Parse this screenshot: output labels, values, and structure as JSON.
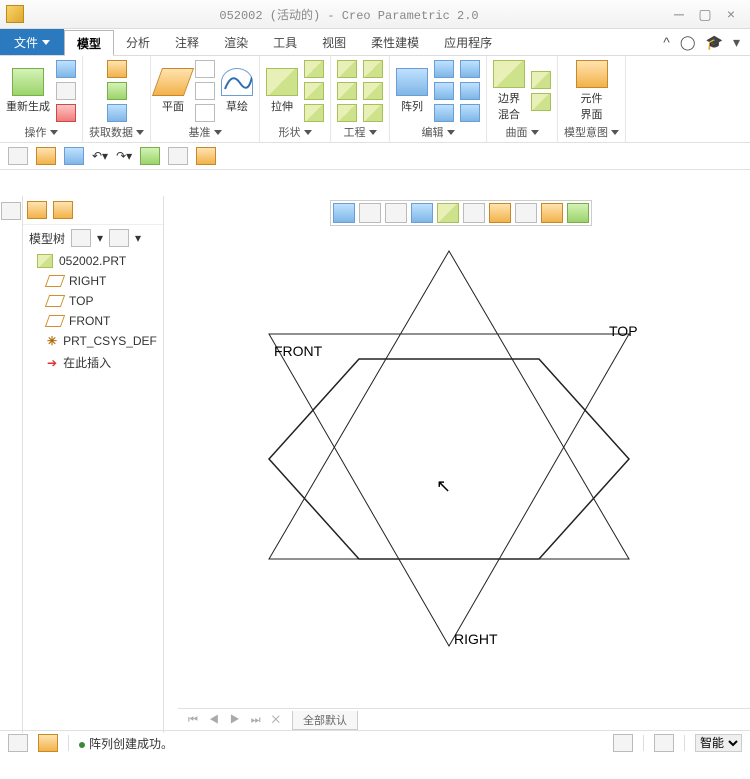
{
  "title": "052002 (活动的) - Creo Parametric 2.0",
  "file_menu": "文件",
  "tabs": [
    "模型",
    "分析",
    "注释",
    "渲染",
    "工具",
    "视图",
    "柔性建模",
    "应用程序"
  ],
  "active_tab_index": 0,
  "ribbon": {
    "regen": "重新生成",
    "plane": "平面",
    "sketch": "草绘",
    "extrude": "拉伸",
    "pattern": "阵列",
    "boundary_blend": "边界\n混合",
    "component_ui": "元件\n界面",
    "g": {
      "ops": "操作",
      "get": "获取数据",
      "datum": "基准",
      "shape": "形状",
      "eng": "工程",
      "edit": "编辑",
      "surf": "曲面",
      "intent": "模型意图"
    }
  },
  "tree": {
    "header_label": "模型树",
    "root": "052002.PRT",
    "items": [
      {
        "label": "RIGHT",
        "type": "plane"
      },
      {
        "label": "TOP",
        "type": "plane"
      },
      {
        "label": "FRONT",
        "type": "plane"
      },
      {
        "label": "PRT_CSYS_DEF",
        "type": "csys"
      },
      {
        "label": "在此插入",
        "type": "insert"
      }
    ]
  },
  "labels": {
    "front": "FRONT",
    "top": "TOP",
    "right": "RIGHT"
  },
  "view_tabs": {
    "default": "全部默认"
  },
  "status": {
    "msg": "阵列创建成功。",
    "filter": "智能"
  }
}
